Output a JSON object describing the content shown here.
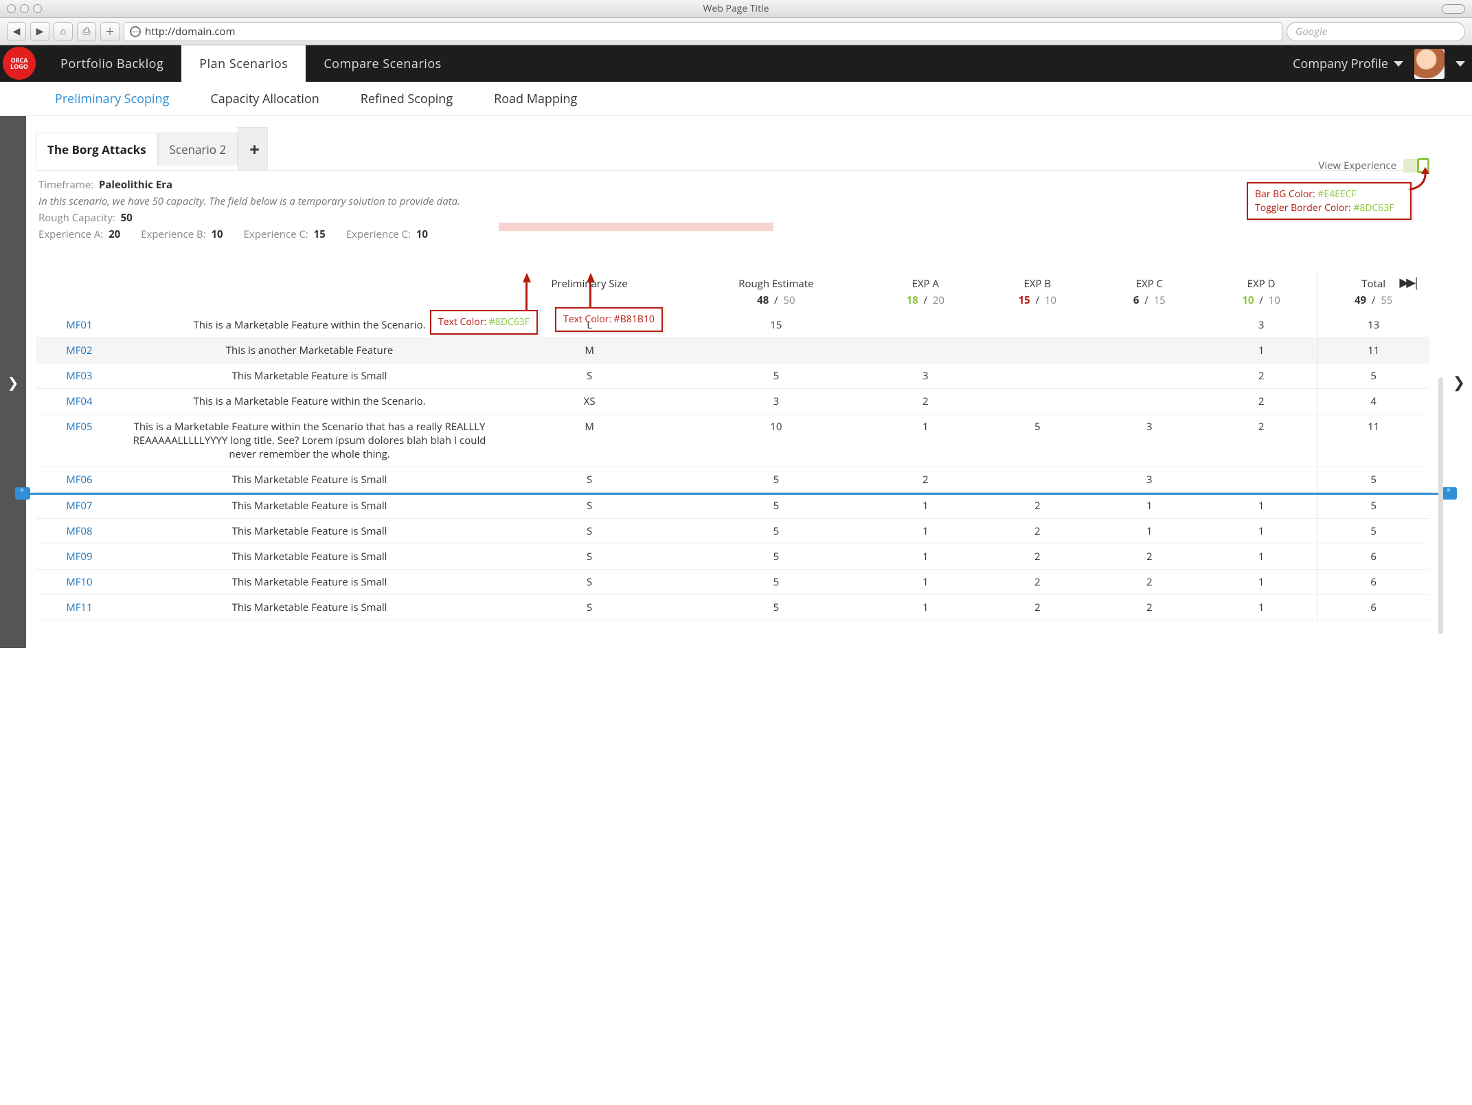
{
  "window": {
    "title": "Web Page Title",
    "url": "http://domain.com",
    "search_placeholder": "Google"
  },
  "logo_text": "ORCA LOGO",
  "nav": {
    "tabs": [
      "Portfolio Backlog",
      "Plan Scenarios",
      "Compare Scenarios"
    ],
    "active": 1,
    "profile": "Company Profile"
  },
  "subnav": {
    "items": [
      "Preliminary Scoping",
      "Capacity Allocation",
      "Refined Scoping",
      "Road Mapping"
    ],
    "active": 0
  },
  "scenarios": {
    "tabs": [
      "The Borg Attacks",
      "Scenario 2"
    ],
    "active": 0
  },
  "meta": {
    "timeframe_label": "Timeframe:",
    "timeframe_value": "Paleolithic Era",
    "desc": "In this scenario, we have 50 capacity. The field below is a temporary solution to provide data.",
    "rough_label": "Rough Capacity:",
    "rough_value": "50",
    "exps": [
      {
        "label": "Experience A:",
        "val": "20"
      },
      {
        "label": "Experience B:",
        "val": "10"
      },
      {
        "label": "Experience C:",
        "val": "15"
      },
      {
        "label": "Experience C:",
        "val": "10"
      }
    ],
    "view_exp_label": "View Experience"
  },
  "annotations": {
    "toggle": {
      "line1_label": "Bar BG Color:",
      "line1_val": "#E4EECF",
      "line2_label": "Toggler Border Color:",
      "line2_val": "#8DC63F"
    },
    "green_text": {
      "label": "Text Color:",
      "val": "#8DC63F"
    },
    "red_text": {
      "label": "Text Color:",
      "val": "#B81B10"
    }
  },
  "columns": {
    "prelim": "Preliminary Size",
    "rough": "Rough Estimate",
    "exps": [
      "EXP A",
      "EXP B",
      "EXP C",
      "EXP D"
    ],
    "total": "Total"
  },
  "totals": {
    "rough": {
      "a": "48",
      "b": "50",
      "style": ""
    },
    "exps": [
      {
        "a": "18",
        "b": "20",
        "astyle": "green",
        "bstyle": "green"
      },
      {
        "a": "15",
        "b": "10",
        "astyle": "red",
        "bstyle": "red"
      },
      {
        "a": "6",
        "b": "15",
        "astyle": "",
        "bstyle": ""
      },
      {
        "a": "10",
        "b": "10",
        "astyle": "green",
        "bstyle": "green"
      }
    ],
    "total": {
      "a": "49",
      "b": "55"
    }
  },
  "rows": [
    {
      "id": "MF01",
      "title": "This is a Marketable Feature within the Scenario.",
      "size": "L",
      "est": "15",
      "e": [
        "",
        "",
        "",
        "3"
      ],
      "tot": "13"
    },
    {
      "id": "MF02",
      "title": "This is another Marketable Feature",
      "size": "M",
      "est": "",
      "e": [
        "",
        "",
        "",
        "1"
      ],
      "tot": "11",
      "sel": true
    },
    {
      "id": "MF03",
      "title": "This Marketable Feature is Small",
      "size": "S",
      "est": "5",
      "e": [
        "3",
        "",
        "",
        "2"
      ],
      "tot": "5"
    },
    {
      "id": "MF04",
      "title": "This is a Marketable Feature within the Scenario.",
      "size": "XS",
      "est": "3",
      "e": [
        "2",
        "",
        "",
        "2"
      ],
      "tot": "4"
    },
    {
      "id": "MF05",
      "title": "This is a Marketable Feature within the Scenario that has a really REALLLY REAAAAALLLLLYYYY long title. See? Lorem ipsum dolores blah blah I could never remember the whole thing.",
      "size": "M",
      "est": "10",
      "e": [
        "1",
        "5",
        "3",
        "2"
      ],
      "tot": "11"
    },
    {
      "id": "MF06",
      "title": "This Marketable Feature is Small",
      "size": "S",
      "est": "5",
      "e": [
        "2",
        "",
        "3",
        ""
      ],
      "tot": "5",
      "cutoff_after": true
    },
    {
      "id": "MF07",
      "title": "This Marketable Feature is Small",
      "size": "S",
      "est": "5",
      "e": [
        "1",
        "2",
        "1",
        "1"
      ],
      "tot": "5"
    },
    {
      "id": "MF08",
      "title": "This Marketable Feature is Small",
      "size": "S",
      "est": "5",
      "e": [
        "1",
        "2",
        "1",
        "1"
      ],
      "tot": "5"
    },
    {
      "id": "MF09",
      "title": "This Marketable Feature is Small",
      "size": "S",
      "est": "5",
      "e": [
        "1",
        "2",
        "2",
        "1"
      ],
      "tot": "6"
    },
    {
      "id": "MF10",
      "title": "This Marketable Feature is Small",
      "size": "S",
      "est": "5",
      "e": [
        "1",
        "2",
        "2",
        "1"
      ],
      "tot": "6"
    },
    {
      "id": "MF11",
      "title": "This Marketable Feature is Small",
      "size": "S",
      "est": "5",
      "e": [
        "1",
        "2",
        "2",
        "1"
      ],
      "tot": "6"
    }
  ]
}
